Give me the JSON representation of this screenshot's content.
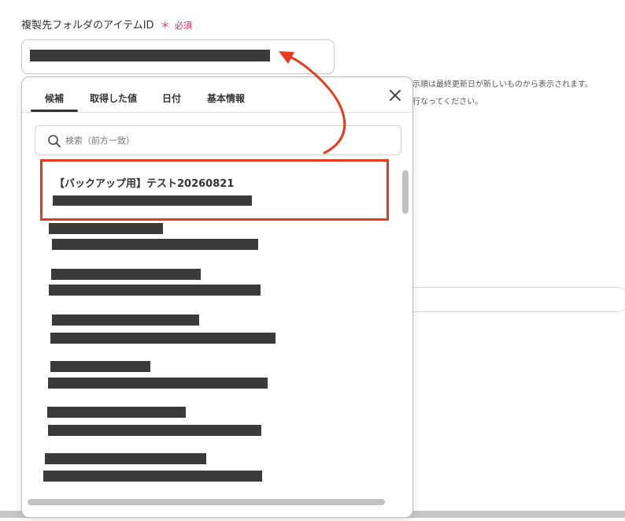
{
  "field": {
    "label": "複製先フォルダのアイテムID",
    "required_star": "＊",
    "required_text": "必須"
  },
  "background": {
    "note_line1": "示順は最終更新日が新しいものから表示されます。",
    "note_line2": "行なってください。"
  },
  "popup": {
    "tabs": [
      {
        "label": "候補",
        "active": true
      },
      {
        "label": "取得した値",
        "active": false
      },
      {
        "label": "日付",
        "active": false
      },
      {
        "label": "基本情報",
        "active": false
      }
    ],
    "search": {
      "placeholder": "検索（前方一致）",
      "value": ""
    },
    "items": [
      {
        "title": "【バックアップ用】テスト20260821",
        "highlighted": true
      }
    ]
  },
  "colors": {
    "accent_red": "#e63a1f",
    "required_pink": "#e0245e",
    "redaction": "#3a3a3a"
  },
  "icons": [
    "search-icon",
    "close-icon",
    "arrow-annotation"
  ]
}
